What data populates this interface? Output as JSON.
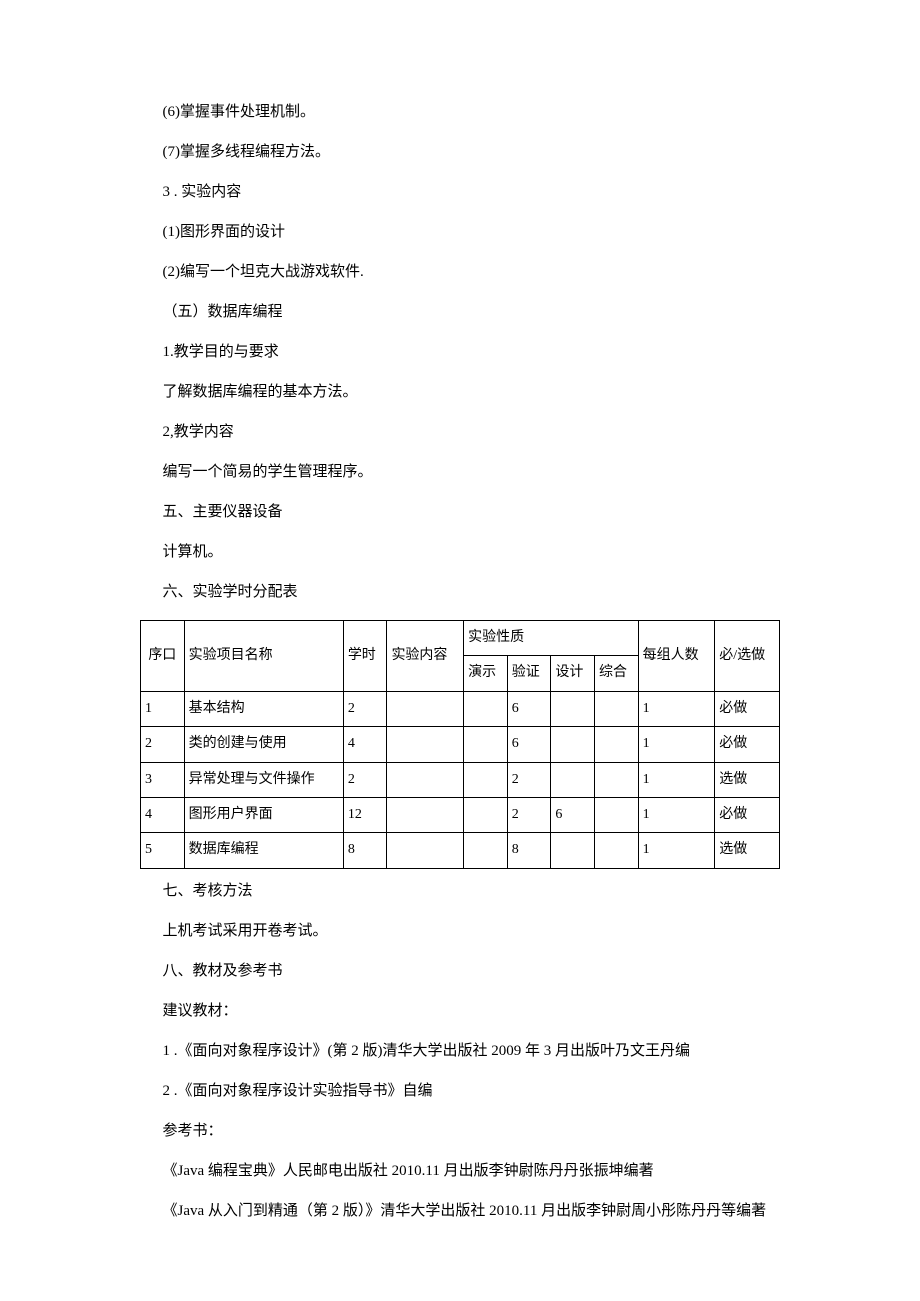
{
  "lines": [
    "(6)掌握事件处理机制。",
    "(7)掌握多线程编程方法。",
    "3  . 实验内容",
    "(1)图形界面的设计",
    "(2)编写一个坦克大战游戏软件.",
    "（五）数据库编程",
    "1.教学目的与要求",
    "了解数据库编程的基本方法。",
    "2,教学内容",
    "编写一个简易的学生管理程序。",
    "五、主要仪器设备",
    "计算机。",
    "六、实验学时分配表"
  ],
  "table": {
    "headers": {
      "seq": "序口",
      "seq_alt": "序\n口",
      "name": "实验项目名称",
      "hours": "学时",
      "content": "实验内容",
      "nature": "实验性质",
      "demo": "演示",
      "verify": "验证",
      "design": "设计",
      "comprehensive": "综合",
      "group_size": "每组人数",
      "required": "必/选做"
    },
    "rows": [
      {
        "seq": "1",
        "name": "基本结构",
        "hours": "2",
        "content": "",
        "demo": "",
        "verify": "6",
        "design": "",
        "comprehensive": "",
        "group_size": "1",
        "required": "必做"
      },
      {
        "seq": "2",
        "name": "类的创建与使用",
        "hours": "4",
        "content": "",
        "demo": "",
        "verify": "6",
        "design": "",
        "comprehensive": "",
        "group_size": "1",
        "required": "必做"
      },
      {
        "seq": "3",
        "name": "异常处理与文件操作",
        "hours": "2",
        "content": "",
        "demo": "",
        "verify": "2",
        "design": "",
        "comprehensive": "",
        "group_size": "1",
        "required": "选做"
      },
      {
        "seq": "4",
        "name": "图形用户界面",
        "hours": "12",
        "content": "",
        "demo": "",
        "verify": "2",
        "design": "6",
        "comprehensive": "",
        "group_size": "1",
        "required": "必做"
      },
      {
        "seq": "5",
        "name": "数据库编程",
        "hours": "8",
        "content": "",
        "demo": "",
        "verify": "8",
        "design": "",
        "comprehensive": "",
        "group_size": "1",
        "required": "选做"
      }
    ]
  },
  "after_lines": [
    {
      "text": "七、考核方法",
      "indent": true
    },
    {
      "text": "上机考试采用开卷考试。",
      "indent": true
    },
    {
      "text": "八、教材及参考书",
      "indent": true
    },
    {
      "text": "建议教材：",
      "indent": true
    },
    {
      "text": "1  .《面向对象程序设计》(第 2 版)清华大学出版社 2009 年 3 月出版叶乃文王丹编",
      "indent": true
    },
    {
      "text": "",
      "indent": false
    },
    {
      "text": "2  .《面向对象程序设计实验指导书》自编",
      "indent": true
    },
    {
      "text": "参考书：",
      "indent": true
    },
    {
      "text": "《Java 编程宝典》人民邮电出版社 2010.11 月出版李钟尉陈丹丹张振坤编著",
      "indent": true
    },
    {
      "text": "《Java 从入门到精通（第 2 版）》清华大学出版社 2010.11 月出版李钟尉周小彤陈丹丹等编著",
      "indent": true
    }
  ]
}
